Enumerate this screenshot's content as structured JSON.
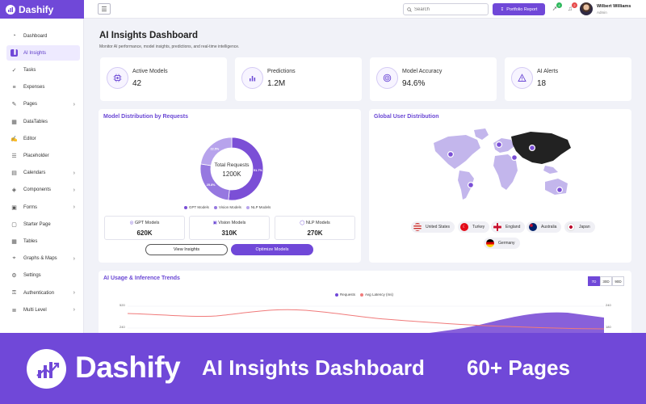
{
  "brand": {
    "name": "Dashify"
  },
  "topbar": {
    "search_placeholder": "Search",
    "portfolio_label": "Portfolio Report",
    "badges": [
      "4",
      "2"
    ],
    "user_name": "Wilbert Williams",
    "user_role": "Admin"
  },
  "sidebar": {
    "items": [
      {
        "label": "Dashboard",
        "icon": "dashboard-icon",
        "active": false,
        "chevron": false
      },
      {
        "label": "AI Insights",
        "icon": "bar-chart-icon",
        "active": true,
        "chevron": false
      },
      {
        "label": "Tasks",
        "icon": "tasks-icon",
        "active": false,
        "chevron": false
      },
      {
        "label": "Expenses",
        "icon": "expenses-icon",
        "active": false,
        "chevron": false
      },
      {
        "label": "Pages",
        "icon": "pages-icon",
        "active": false,
        "chevron": true
      },
      {
        "label": "DataTables",
        "icon": "datatable-icon",
        "active": false,
        "chevron": false
      },
      {
        "label": "Editor",
        "icon": "editor-icon",
        "active": false,
        "chevron": false
      },
      {
        "label": "Placeholder",
        "icon": "placeholder-icon",
        "active": false,
        "chevron": false
      },
      {
        "label": "Calendars",
        "icon": "calendar-icon",
        "active": false,
        "chevron": true
      },
      {
        "label": "Components",
        "icon": "layers-icon",
        "active": false,
        "chevron": true
      },
      {
        "label": "Forms",
        "icon": "forms-icon",
        "active": false,
        "chevron": true
      },
      {
        "label": "Starter Page",
        "icon": "starter-icon",
        "active": false,
        "chevron": false
      },
      {
        "label": "Tables",
        "icon": "table-icon",
        "active": false,
        "chevron": false
      },
      {
        "label": "Graphs & Maps",
        "icon": "map-pin-icon",
        "active": false,
        "chevron": true
      },
      {
        "label": "Settings",
        "icon": "gear-icon",
        "active": false,
        "chevron": false
      },
      {
        "label": "Authentication",
        "icon": "lock-icon",
        "active": false,
        "chevron": true
      },
      {
        "label": "Multi Level",
        "icon": "multilevel-icon",
        "active": false,
        "chevron": true
      }
    ]
  },
  "page": {
    "title": "AI Insights Dashboard",
    "subtitle": "Monitor AI performance, model insights, predictions, and real-time intelligence."
  },
  "stats": [
    {
      "label": "Active Models",
      "value": "42",
      "icon": "chip-icon"
    },
    {
      "label": "Predictions",
      "value": "1.2M",
      "icon": "bar-chart-icon"
    },
    {
      "label": "Model Accuracy",
      "value": "94.6%",
      "icon": "target-icon"
    },
    {
      "label": "AI Alerts",
      "value": "18",
      "icon": "alert-triangle-icon"
    }
  ],
  "distribution": {
    "title": "Model Distribution by Requests",
    "center_label": "Total Requests",
    "center_value": "1200K",
    "models": [
      {
        "name": "GPT Models",
        "value": "620K",
        "icon": "gpt-icon"
      },
      {
        "name": "Vision Models",
        "value": "310K",
        "icon": "vision-icon"
      },
      {
        "name": "NLP Models",
        "value": "270K",
        "icon": "nlp-icon"
      }
    ],
    "buttons": {
      "view": "View Insights",
      "optimize": "Optimize Models"
    }
  },
  "geo": {
    "title": "Global User Distribution",
    "countries": [
      {
        "name": "United States",
        "icon": "flag-us-icon"
      },
      {
        "name": "Turkey",
        "icon": "flag-tr-icon"
      },
      {
        "name": "England",
        "icon": "flag-gb-icon"
      },
      {
        "name": "Australia",
        "icon": "flag-au-icon"
      },
      {
        "name": "Japan",
        "icon": "flag-jp-icon"
      },
      {
        "name": "Germany",
        "icon": "flag-de-icon"
      }
    ]
  },
  "trends": {
    "title": "AI Usage & Inference Trends",
    "ranges": [
      "7D",
      "30D",
      "90D"
    ],
    "active_range": "7D",
    "legend": [
      "Requests",
      "Avg Latency (ms)"
    ]
  },
  "banner": {
    "brand": "Dashify",
    "title": "AI Insights Dashboard",
    "pages": "60+ Pages"
  },
  "colors": {
    "accent": "#7048d8",
    "donut": [
      "#7b4fd6",
      "#9678e0",
      "#b7a3ec"
    ],
    "latency": "#f07a7a",
    "map_land": "#c3b6ec",
    "map_highlight": "#222222"
  },
  "chart_data": {
    "type": "donut",
    "title": "Model Distribution by Requests",
    "categories": [
      "GPT Models",
      "Vision Models",
      "NLP Models"
    ],
    "values": [
      51.7,
      25.8,
      22.5
    ],
    "value_labels": [
      "51.7%",
      "25.8%",
      "22.5%"
    ]
  }
}
